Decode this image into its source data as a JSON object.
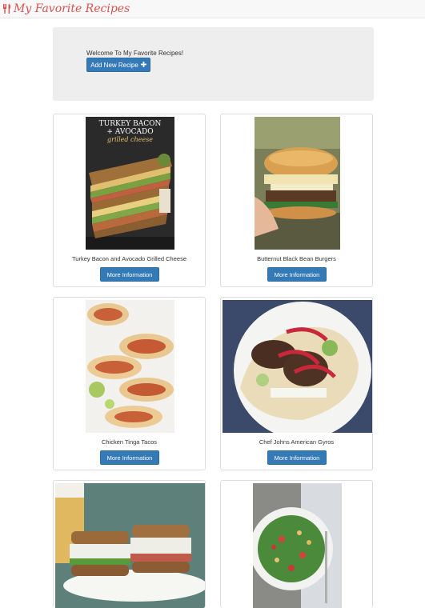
{
  "navbar": {
    "brand_text": "My Favorite Recipes",
    "brand_icon": "utensils-icon",
    "brand_color": "#d9534f"
  },
  "jumbotron": {
    "welcome_text": "Welcome To My Favorite Recipes!",
    "add_button_label": "Add New Recipe",
    "add_button_icon": "plus-icon"
  },
  "theme": {
    "primary": "#337ab7",
    "panel_bg": "#eeeeee",
    "card_border": "#dddddd"
  },
  "recipes": [
    {
      "name": "Turkey Bacon and Avocado Grilled Cheese",
      "button_label": "More Information",
      "image_overlay": [
        "TURKEY BACON",
        "+ AVOCADO",
        "grilled cheese"
      ]
    },
    {
      "name": "Butternut Black Bean Burgers",
      "button_label": "More Information"
    },
    {
      "name": "Chicken Tinga Tacos",
      "button_label": "More Information"
    },
    {
      "name": "Chef Johns American Gyros",
      "button_label": "More Information"
    },
    {
      "name": "",
      "button_label": ""
    },
    {
      "name": "",
      "button_label": ""
    }
  ]
}
